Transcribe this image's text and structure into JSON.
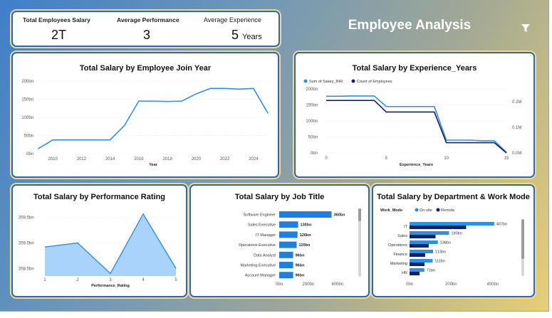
{
  "header": {
    "title": "Employee Analysis",
    "filter_icon": "filter-icon"
  },
  "kpis": [
    {
      "label": "Total Employees Salary",
      "value": "2T",
      "unit": ""
    },
    {
      "label": "Average Performance",
      "value": "3",
      "unit": ""
    },
    {
      "label": "Average Experience",
      "value": "5",
      "unit": "Years"
    }
  ],
  "charts": {
    "join_year": {
      "title": "Total Salary by Employee Join Year",
      "xlabel": "Year",
      "xticks": [
        "2010",
        "2012",
        "2014",
        "2016",
        "2018",
        "2020",
        "2022",
        "2024"
      ],
      "yticks": [
        "0bn",
        "50bn",
        "100bn",
        "150bn",
        "200bn"
      ]
    },
    "experience": {
      "title": "Total Salary by Experience_Years",
      "xlabel": "Experience_Years",
      "legend": [
        "Sum of Salary_INR",
        "Count of Employees"
      ],
      "xticks": [
        "0",
        "5",
        "10",
        "15"
      ],
      "yticks_left": [
        "0bn",
        "50bn",
        "100bn",
        "150bn",
        "200bn"
      ],
      "yticks_right": [
        "0.0M",
        "0.1M",
        "0.2M"
      ]
    },
    "performance": {
      "title": "Total Salary by Performance Rating",
      "xlabel": "Performance_Rating",
      "xticks": [
        "1",
        "2",
        "3",
        "4",
        "5"
      ],
      "yticks": [
        "358.5bn",
        "359.0bn",
        "359.5bn"
      ]
    },
    "job_title": {
      "title": "Total Salary by Job Title",
      "xticks": [
        "0bn",
        "200bn",
        "400bn"
      ]
    },
    "department": {
      "title": "Total Salary by Department & Work Mode",
      "legend_title": "Work_Mode",
      "legend": [
        "On-site",
        "Remote"
      ],
      "xticks": [
        "0bn",
        "200bn",
        "400bn"
      ]
    }
  },
  "chart_data": [
    {
      "type": "line",
      "title": "Total Salary by Employee Join Year",
      "xlabel": "Year",
      "ylabel": "",
      "x": [
        2009,
        2010,
        2011,
        2012,
        2013,
        2014,
        2015,
        2016,
        2017,
        2018,
        2019,
        2020,
        2021,
        2022,
        2023,
        2024,
        2025
      ],
      "series": [
        {
          "name": "",
          "values": [
            14,
            38,
            38,
            38,
            38,
            38,
            78,
            145,
            145,
            144,
            145,
            165,
            180,
            180,
            178,
            180,
            112
          ]
        }
      ],
      "ylim": [
        0,
        210
      ]
    },
    {
      "type": "line",
      "title": "Total Salary by Experience_Years",
      "xlabel": "Experience_Years",
      "x": [
        0,
        1,
        2,
        3,
        4,
        5,
        6,
        7,
        8,
        9,
        10,
        11,
        12,
        13,
        14,
        15
      ],
      "series": [
        {
          "name": "Sum of Salary_INR",
          "axis": "left",
          "values": [
            177,
            177,
            178,
            178,
            178,
            145,
            145,
            145,
            145,
            145,
            40,
            40,
            40,
            38,
            38,
            2
          ]
        },
        {
          "name": "Count of Employees",
          "axis": "right",
          "values": [
            0.205,
            0.205,
            0.205,
            0.205,
            0.205,
            0.16,
            0.16,
            0.16,
            0.16,
            0.16,
            0.04,
            0.04,
            0.04,
            0.04,
            0.04,
            0.0
          ]
        }
      ],
      "ylim": [
        0,
        200
      ],
      "ylim_right": [
        0,
        0.25
      ]
    },
    {
      "type": "area",
      "title": "Total Salary by Performance Rating",
      "xlabel": "Performance_Rating",
      "x": [
        1,
        2,
        3,
        4,
        5
      ],
      "series": [
        {
          "name": "",
          "values": [
            358.92,
            359.0,
            358.4,
            359.57,
            358.5
          ]
        }
      ],
      "ylim": [
        358.35,
        359.65
      ]
    },
    {
      "type": "bar",
      "title": "Total Salary by Job Title",
      "orientation": "horizontal",
      "categories": [
        "Software Engineer",
        "Sales Executive",
        "IT Manager",
        "Operations Executive",
        "Data Analyst",
        "Marketing Executive",
        "Account Manager"
      ],
      "values": [
        360,
        130,
        126,
        120,
        96,
        96,
        96
      ],
      "labels": [
        "360bn",
        "130bn",
        "126bn",
        "120bn",
        "96bn",
        "96bn",
        "96bn"
      ],
      "xlim": [
        0,
        480
      ]
    },
    {
      "type": "bar",
      "title": "Total Salary by Department & Work Mode",
      "orientation": "horizontal",
      "categories": [
        "IT",
        "Sales",
        "Operations",
        "Finance",
        "Marketing",
        "HR"
      ],
      "series": [
        {
          "name": "On-site",
          "values": [
            407,
            190,
            136,
            113,
            111,
            71
          ]
        },
        {
          "name": "Remote",
          "values": [
            272,
            125,
            92,
            75,
            72,
            48
          ]
        }
      ],
      "labels": [
        "407bn",
        "190bn",
        "136bn",
        "113bn",
        "111bn",
        "71bn"
      ],
      "xlim": [
        0,
        500
      ]
    }
  ],
  "colors": {
    "light_blue": "#2f8fe0",
    "dark_navy": "#15206b",
    "bar_blue": "#1e7fe0",
    "area_fill": "#a9d3fb",
    "card_border": "#2f66b3"
  }
}
